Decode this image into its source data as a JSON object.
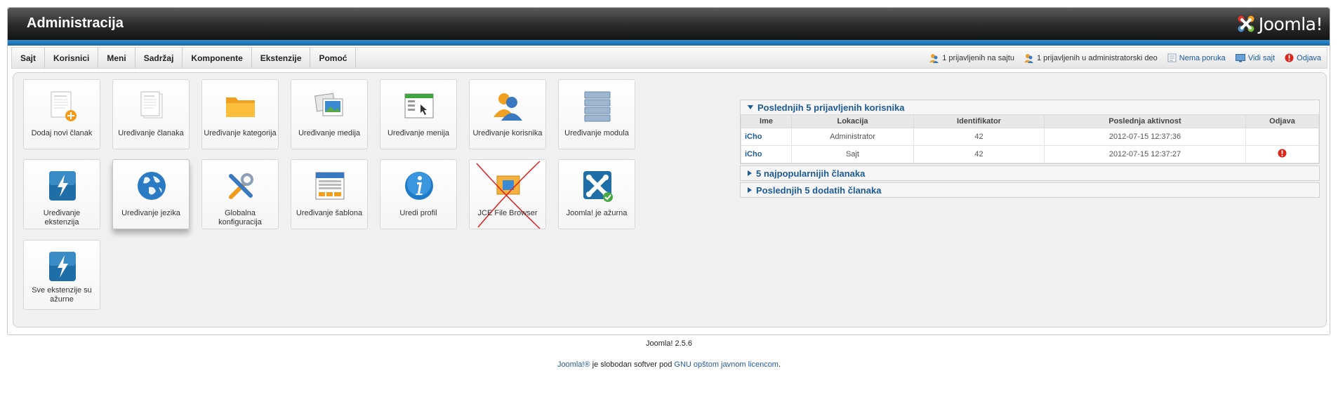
{
  "header": {
    "title": "Administracija",
    "logo_text": "Joomla!"
  },
  "menu": {
    "items": [
      "Sajt",
      "Korisnici",
      "Meni",
      "Sadržaj",
      "Komponente",
      "Ekstenzije",
      "Pomoć"
    ]
  },
  "status": {
    "site_users": "1 prijavljenih na sajtu",
    "admin_users": "1 prijavljenih u administratorski deo",
    "messages": "Nema poruka",
    "view_site": "Vidi sajt",
    "logout": "Odjava"
  },
  "quick_icons": [
    {
      "label": "Dodaj novi članak",
      "icon": "article-add-icon"
    },
    {
      "label": "Uređivanje članaka",
      "icon": "article-icon"
    },
    {
      "label": "Uređivanje kategorija",
      "icon": "folder-icon"
    },
    {
      "label": "Uređivanje medija",
      "icon": "media-icon"
    },
    {
      "label": "Uređivanje menija",
      "icon": "menu-icon"
    },
    {
      "label": "Uređivanje korisnika",
      "icon": "user-icon"
    },
    {
      "label": "Uređivanje modula",
      "icon": "module-icon"
    },
    {
      "label": "Uređivanje ekstenzija",
      "icon": "extension-icon"
    },
    {
      "label": "Uređivanje jezika",
      "icon": "globe-icon"
    },
    {
      "label": "Globalna konfiguracija",
      "icon": "config-icon"
    },
    {
      "label": "Uređivanje šablona",
      "icon": "template-icon"
    },
    {
      "label": "Uredi profil",
      "icon": "info-icon"
    },
    {
      "label": "JCE File Browser",
      "icon": "file-browser-icon"
    },
    {
      "label": "Joomla! je ažurna",
      "icon": "joomla-update-icon"
    },
    {
      "label": "Sve ekstenzije su ažurne",
      "icon": "extension-update-icon"
    }
  ],
  "panel": {
    "logged_title": "Poslednjih 5 prijavljenih korisnika",
    "popular_title": "5 najpopularnijih članaka",
    "latest_title": "Poslednjih 5 dodatih članaka",
    "columns": [
      "Ime",
      "Lokacija",
      "Identifikator",
      "Poslednja aktivnost",
      "Odjava"
    ],
    "rows": [
      {
        "name": "iCho",
        "location": "Administrator",
        "id": "42",
        "activity": "2012-07-15 12:37:36"
      },
      {
        "name": "iCho",
        "location": "Sajt",
        "id": "42",
        "activity": "2012-07-15 12:37:27"
      }
    ]
  },
  "footer": {
    "version": "Joomla! 2.5.6",
    "joomla_link": "Joomla!®",
    "license_text": " je slobodan softver pod ",
    "license_link": "GNU opštom javnom licencom",
    "period": "."
  }
}
